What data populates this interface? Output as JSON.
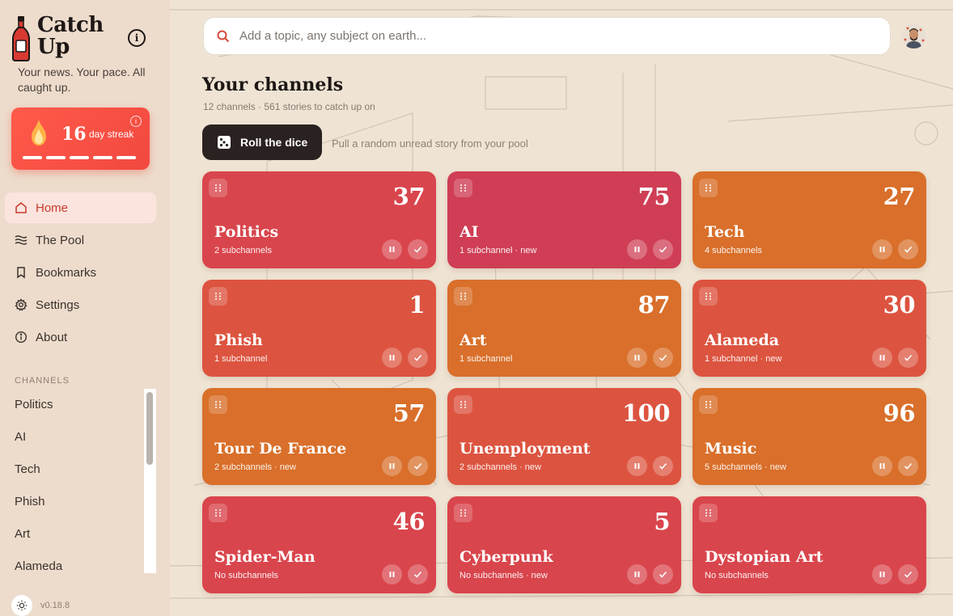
{
  "app": {
    "title_line1": "Catch",
    "title_line2": "Up",
    "tagline": "Your news. Your pace. All caught up.",
    "version": "v0.18.8"
  },
  "streak": {
    "count": "16",
    "label": "day streak",
    "progress_segments": 5
  },
  "nav": [
    {
      "label": "Home",
      "icon": "home-icon",
      "active": true
    },
    {
      "label": "The Pool",
      "icon": "waves-icon",
      "active": false
    },
    {
      "label": "Bookmarks",
      "icon": "bookmark-icon",
      "active": false
    },
    {
      "label": "Settings",
      "icon": "gear-icon",
      "active": false
    },
    {
      "label": "About",
      "icon": "info-icon",
      "active": false
    }
  ],
  "sidebar_channels": {
    "heading": "CHANNELS",
    "items": [
      "Politics",
      "AI",
      "Tech",
      "Phish",
      "Art",
      "Alameda"
    ]
  },
  "search": {
    "placeholder": "Add a topic, any subject on earth..."
  },
  "main": {
    "title": "Your channels",
    "subtitle": "12 channels · 561 stories to catch up on",
    "roll_label": "Roll the dice",
    "roll_hint": "Pull a random unread story from your pool"
  },
  "colors": {
    "red": "#d9454c",
    "rose": "#cf3e55",
    "orange": "#d96f2a",
    "coral": "#dc5440",
    "accent": "#f2483f"
  },
  "cards": [
    {
      "name": "Politics",
      "count": "37",
      "meta": "2 subchannels",
      "color": "red"
    },
    {
      "name": "AI",
      "count": "75",
      "meta": "1 subchannel · new",
      "color": "rose"
    },
    {
      "name": "Tech",
      "count": "27",
      "meta": "4 subchannels",
      "color": "orange"
    },
    {
      "name": "Phish",
      "count": "1",
      "meta": "1 subchannel",
      "color": "coral"
    },
    {
      "name": "Art",
      "count": "87",
      "meta": "1 subchannel",
      "color": "orange"
    },
    {
      "name": "Alameda",
      "count": "30",
      "meta": "1 subchannel · new",
      "color": "coral"
    },
    {
      "name": "Tour De France",
      "count": "57",
      "meta": "2 subchannels · new",
      "color": "orange"
    },
    {
      "name": "Unemployment",
      "count": "100",
      "meta": "2 subchannels · new",
      "color": "coral"
    },
    {
      "name": "Music",
      "count": "96",
      "meta": "5 subchannels · new",
      "color": "orange"
    },
    {
      "name": "Spider-Man",
      "count": "46",
      "meta": "No subchannels",
      "color": "red"
    },
    {
      "name": "Cyberpunk",
      "count": "5",
      "meta": "No subchannels · new",
      "color": "red"
    },
    {
      "name": "Dystopian Art",
      "count": "",
      "meta": "No subchannels",
      "color": "red"
    }
  ]
}
